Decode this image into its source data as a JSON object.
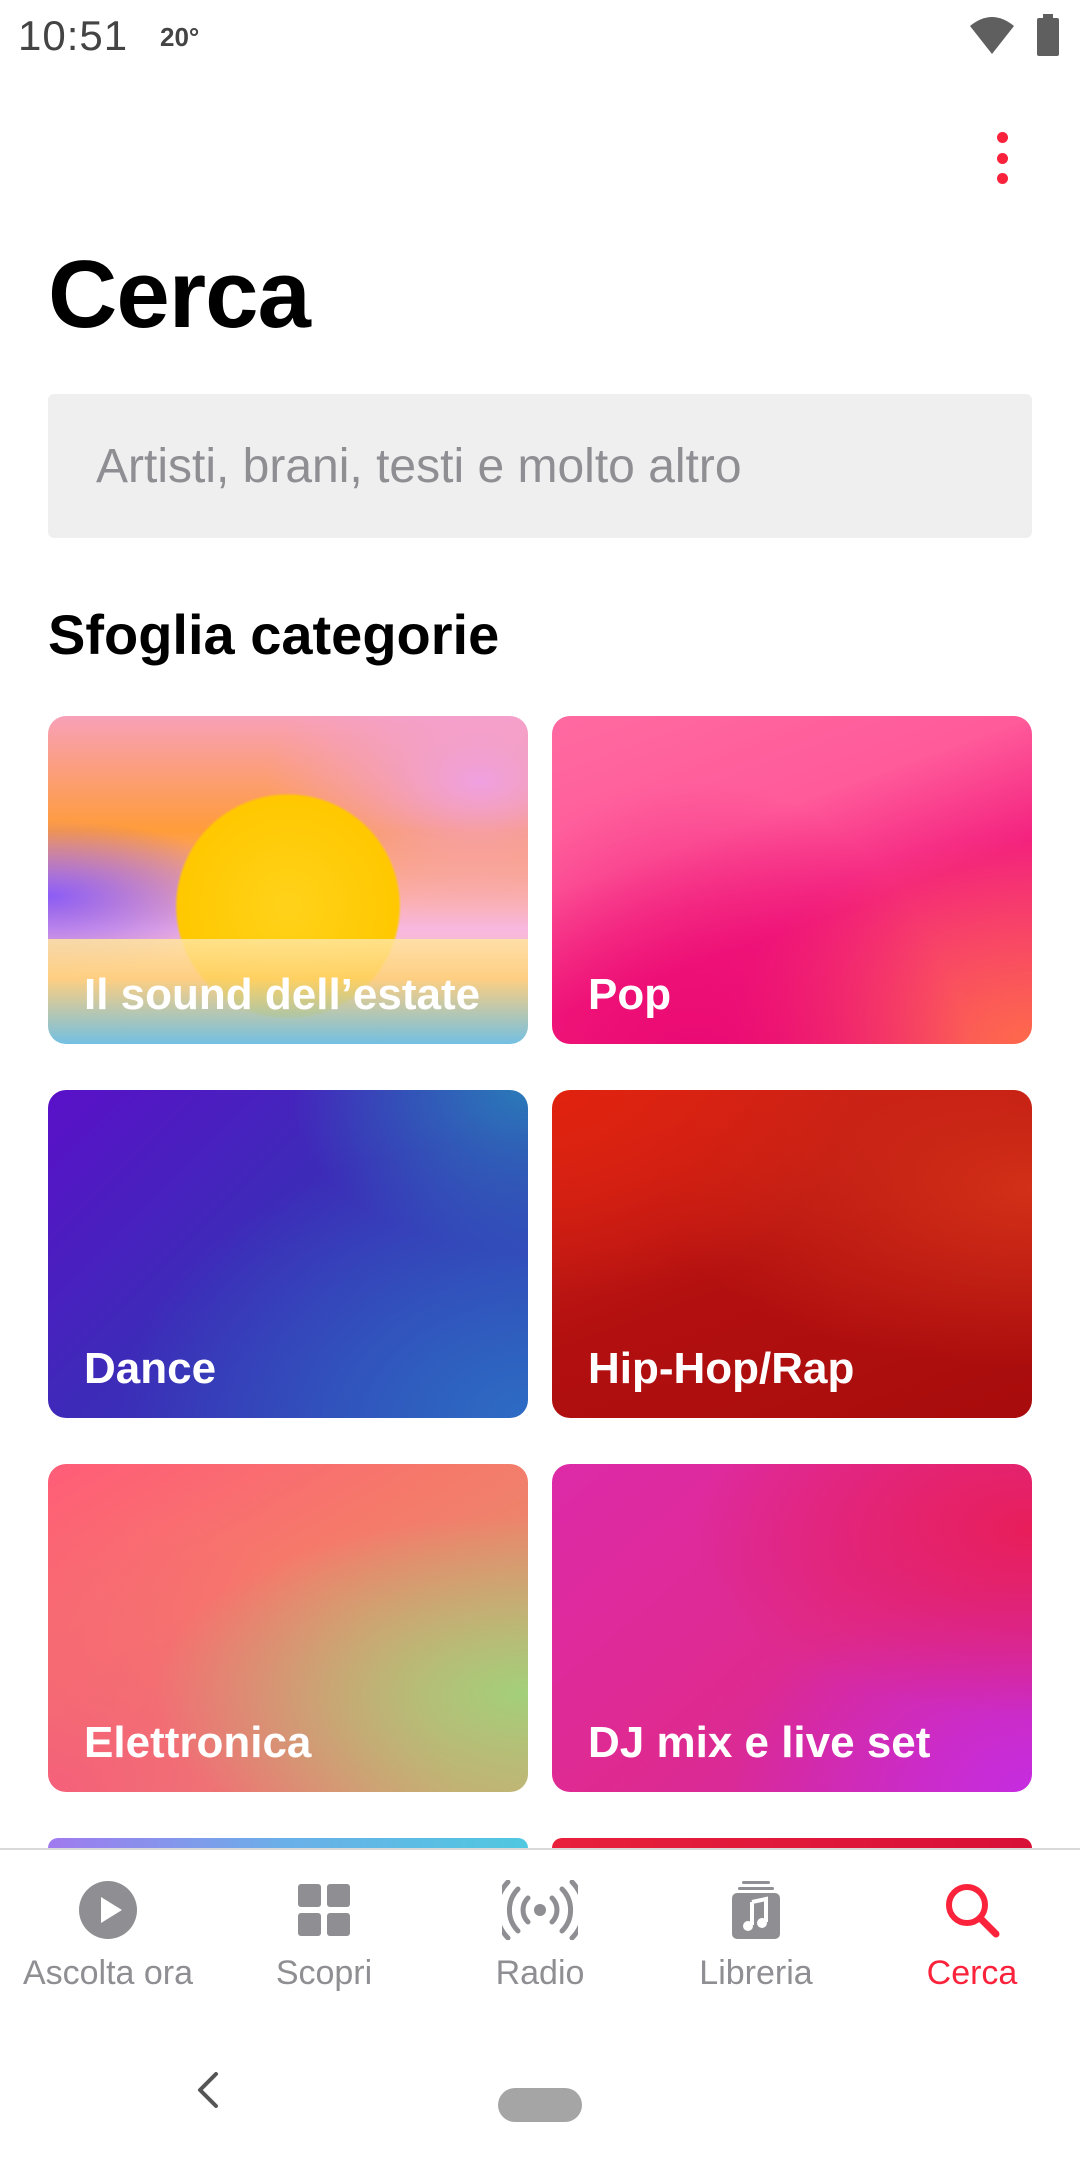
{
  "status_bar": {
    "time": "10:51",
    "temperature": "20°",
    "icons": [
      "wifi-icon",
      "battery-icon"
    ]
  },
  "header": {
    "menu_icon": "more-vert-icon",
    "title": "Cerca"
  },
  "search": {
    "placeholder": "Artisti, brani, testi e molto altro",
    "value": ""
  },
  "browse": {
    "section_title": "Sfoglia categorie",
    "categories": [
      {
        "label": "Il sound dell’estate"
      },
      {
        "label": "Pop"
      },
      {
        "label": "Dance"
      },
      {
        "label": "Hip-Hop/Rap"
      },
      {
        "label": "Elettronica"
      },
      {
        "label": "DJ mix e live set"
      }
    ]
  },
  "tab_bar": {
    "tabs": [
      {
        "label": "Ascolta ora",
        "icon": "play-circle-icon",
        "active": false
      },
      {
        "label": "Scopri",
        "icon": "grid-icon",
        "active": false
      },
      {
        "label": "Radio",
        "icon": "radio-broadcast-icon",
        "active": false
      },
      {
        "label": "Libreria",
        "icon": "library-music-icon",
        "active": false
      },
      {
        "label": "Cerca",
        "icon": "search-icon",
        "active": true
      }
    ]
  },
  "colors": {
    "accent": "#fa233b",
    "inactive_tab": "#8e8e93",
    "search_background": "#efeff0"
  }
}
